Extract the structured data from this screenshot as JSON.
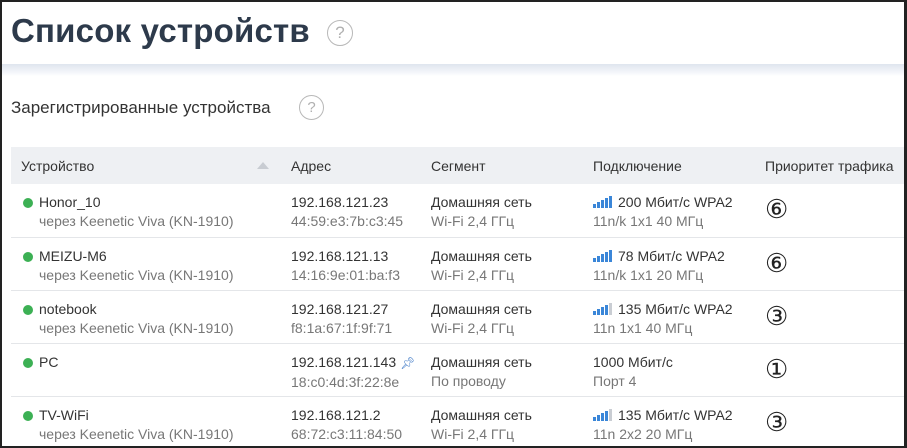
{
  "page": {
    "title": "Список устройств"
  },
  "section": {
    "title": "Зарегистрированные устройства"
  },
  "table": {
    "headers": {
      "device": "Устройство",
      "address": "Адрес",
      "segment": "Сегмент",
      "connection": "Подключение",
      "priority": "Приоритет трафика"
    },
    "rows": [
      {
        "name": "Honor_10",
        "via": "через Keenetic Viva (KN-1910)",
        "ip": "192.168.121.23",
        "mac": "44:59:e3:7b:c3:45",
        "segment": "Домашняя сеть",
        "segment_sub": "Wi-Fi 2,4 ГГц",
        "speed": "200 Мбит/с WPA2",
        "conn_sub": "11n/k 1x1 40 МГц",
        "signal": 5,
        "priority": "⑥",
        "status_color": "#3cb054"
      },
      {
        "name": "MEIZU-M6",
        "via": "через Keenetic Viva (KN-1910)",
        "ip": "192.168.121.13",
        "mac": "14:16:9e:01:ba:f3",
        "segment": "Домашняя сеть",
        "segment_sub": "Wi-Fi 2,4 ГГц",
        "speed": "78 Мбит/с WPA2",
        "conn_sub": "11n/k 1x1 20 МГц",
        "signal": 5,
        "priority": "⑥",
        "status_color": "#3cb054"
      },
      {
        "name": "notebook",
        "via": "через Keenetic Viva (KN-1910)",
        "ip": "192.168.121.27",
        "mac": "f8:1a:67:1f:9f:71",
        "segment": "Домашняя сеть",
        "segment_sub": "Wi-Fi 2,4 ГГц",
        "speed": "135 Мбит/с WPA2",
        "conn_sub": "11n 1x1 40 МГц",
        "signal": 4,
        "priority": "③",
        "status_color": "#3cb054"
      },
      {
        "name": "PC",
        "via": "",
        "ip": "192.168.121.143",
        "mac": "18:c0:4d:3f:22:8e",
        "segment": "Домашняя сеть",
        "segment_sub": "По проводу",
        "speed": "1000 Мбит/с",
        "conn_sub": "Порт 4",
        "signal": 0,
        "priority": "①",
        "pinned": true,
        "status_color": "#3cb054"
      },
      {
        "name": "TV-WiFi",
        "via": "через Keenetic Viva (KN-1910)",
        "ip": "192.168.121.2",
        "mac": "68:72:c3:11:84:50",
        "segment": "Домашняя сеть",
        "segment_sub": "Wi-Fi 2,4 ГГц",
        "speed": "135 Мбит/с WPA2",
        "conn_sub": "11n 2x2 20 МГц",
        "signal": 4,
        "priority": "③",
        "status_color": "#3cb054"
      }
    ]
  },
  "colors": {
    "accent": "#3a86d8",
    "online": "#3cb054",
    "title": "#2d3a4b"
  }
}
